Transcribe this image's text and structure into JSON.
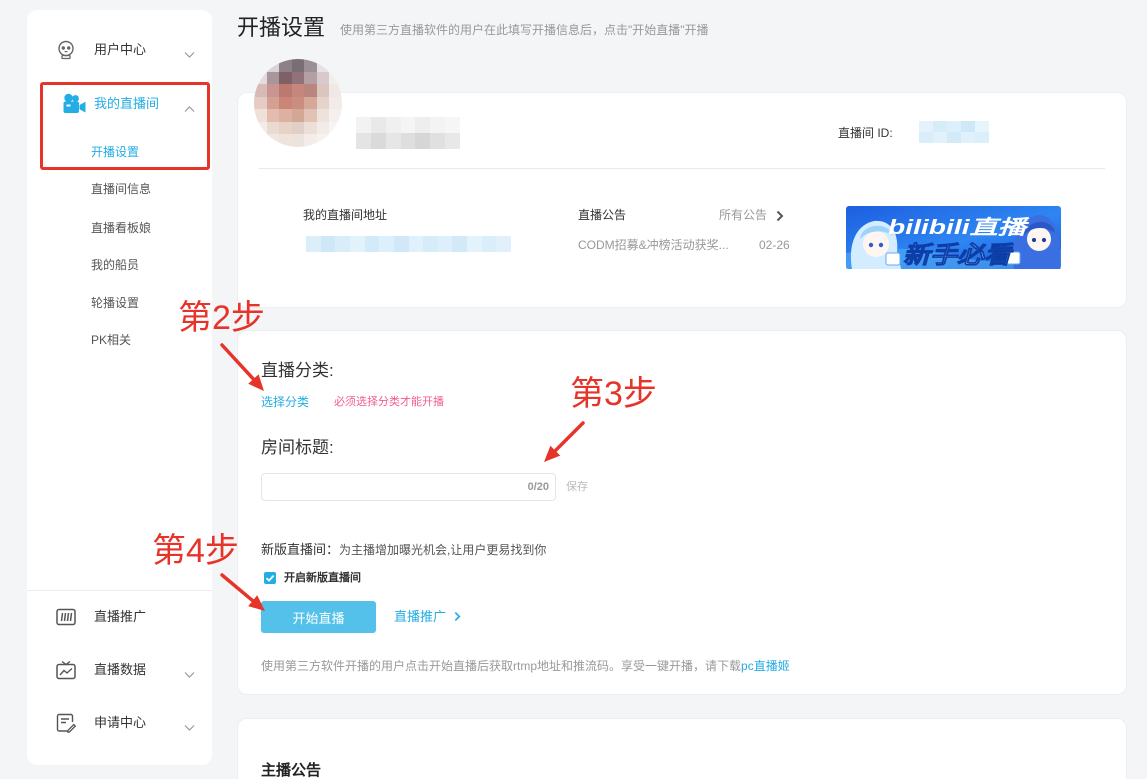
{
  "page": {
    "title": "开播设置",
    "subtitle": "使用第三方直播软件的用户在此填写开播信息后，点击\"开始直播\"开播"
  },
  "sidebar": {
    "user_center": {
      "label": "用户中心",
      "icon": "user-face-icon",
      "expanded": false
    },
    "live_room": {
      "label": "我的直播间",
      "icon": "video-camera-icon",
      "expanded": true,
      "sub_items": [
        {
          "label": "开播设置",
          "active": true
        },
        {
          "label": "直播间信息",
          "active": false
        },
        {
          "label": "直播看板娘",
          "active": false
        },
        {
          "label": "我的船员",
          "active": false
        },
        {
          "label": "轮播设置",
          "active": false
        },
        {
          "label": "PK相关",
          "active": false
        }
      ]
    },
    "bottom_items": [
      {
        "label": "直播推广",
        "icon": "promotion-icon",
        "has_chevron": false
      },
      {
        "label": "直播数据",
        "icon": "tv-chart-icon",
        "has_chevron": true
      },
      {
        "label": "申请中心",
        "icon": "document-edit-icon",
        "has_chevron": true
      }
    ]
  },
  "profile_card": {
    "room_id_label": "直播间 ID:",
    "address_label": "我的直播间地址",
    "announcement": {
      "label": "直播公告",
      "all_link": "所有公告",
      "latest_title": "CODM招募&冲榜活动获奖...",
      "latest_date": "02-26"
    },
    "banner": {
      "line1": "bilibili直播",
      "line2": "新手必看"
    }
  },
  "settings_card": {
    "category": {
      "label": "直播分类:",
      "select_link": "选择分类",
      "warning": "必须选择分类才能开播"
    },
    "room_title": {
      "label": "房间标题:",
      "value": "",
      "counter": "0/20",
      "save": "保存"
    },
    "new_room": {
      "label": "新版直播间：",
      "description": "为主播增加曝光机会,让用户更易找到你",
      "checkbox_label": "开启新版直播间",
      "checked": true
    },
    "start_button": "开始直播",
    "promote_link": "直播推广",
    "footer_text": "使用第三方软件开播的用户点击开始直播后获取rtmp地址和推流码。享受一键开播，请下载",
    "footer_link": "pc直播姬"
  },
  "notice_card": {
    "title": "主播公告"
  },
  "annotations": [
    {
      "text": "第2步"
    },
    {
      "text": "第3步"
    },
    {
      "text": "第4步"
    }
  ],
  "colors": {
    "accent": "#23ade5",
    "warning_pink": "#f25d8e",
    "annotation_red": "#e7342a",
    "button": "#54c1ea"
  }
}
